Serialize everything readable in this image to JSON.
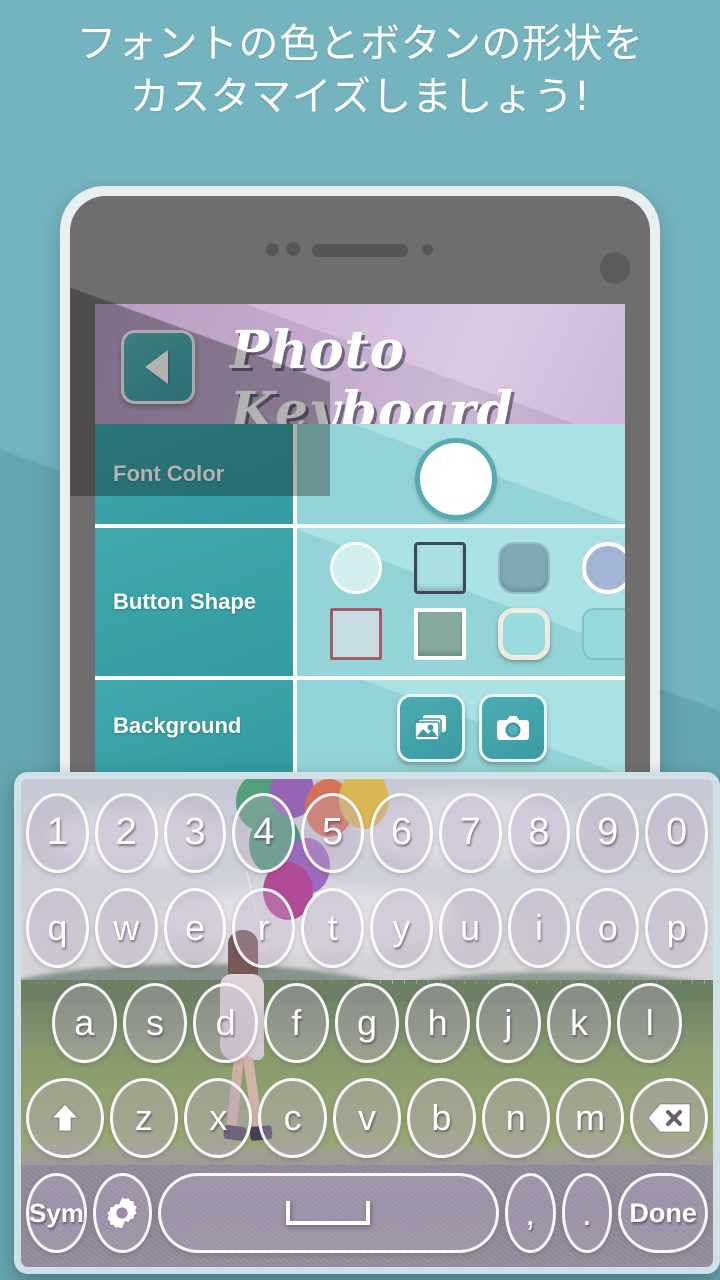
{
  "promo": {
    "line1": "フォントの色とボタンの形状を",
    "line2": "カスタマイズしましょう!",
    "text_color": "#ffffff",
    "background_color": "#6cafba"
  },
  "app": {
    "header": {
      "title": "Photo Keyboard",
      "back_icon": "back-triangle-icon",
      "background_color": "#cdb4d8",
      "back_button_color": "#47a6ac"
    },
    "settings_rows": [
      {
        "label": "Font Color",
        "type": "color",
        "swatches": [
          {
            "name": "white",
            "color": "#ffffff",
            "shape": "circle",
            "selected": true
          }
        ]
      },
      {
        "label": "Button Shape",
        "type": "shape",
        "swatches": [
          {
            "name": "circle-light",
            "shape": "circle",
            "color": "#d2eef0",
            "border": "#ffffff"
          },
          {
            "name": "square-dark-outline",
            "shape": "square",
            "color": "#a9dfe1",
            "border": "#3a4a4f"
          },
          {
            "name": "rounded-slate",
            "shape": "rounded",
            "color": "#7fa9b2",
            "border": "#93bcc4"
          },
          {
            "name": "circle-periwinkle",
            "shape": "circle",
            "color": "#a4b4d4",
            "border": "#ffffff"
          },
          {
            "name": "square-mauve-outline",
            "shape": "square",
            "color": "#c8dde2",
            "border": "#9d5c6a"
          },
          {
            "name": "square-sage",
            "shape": "square",
            "color": "#86a99e",
            "border": "#ffffff"
          },
          {
            "name": "rounded-cream-glow",
            "shape": "rounded",
            "color": "#9adcde",
            "border": "#eeeae2"
          },
          {
            "name": "rounded-teal-flat",
            "shape": "rounded",
            "color": "#95d9da",
            "border": "#7cc2c6"
          }
        ]
      },
      {
        "label": "Background",
        "type": "source",
        "buttons": [
          {
            "name": "gallery-icon",
            "label": "Gallery"
          },
          {
            "name": "camera-icon",
            "label": "Camera"
          }
        ]
      }
    ],
    "label_bg_color": "#3fa8ad",
    "body_bg_color": "#9adcde"
  },
  "keyboard": {
    "rows": [
      {
        "name": "number-row",
        "keys": [
          {
            "label": "1"
          },
          {
            "label": "2"
          },
          {
            "label": "3"
          },
          {
            "label": "4"
          },
          {
            "label": "5"
          },
          {
            "label": "6"
          },
          {
            "label": "7"
          },
          {
            "label": "8"
          },
          {
            "label": "9"
          },
          {
            "label": "0"
          }
        ]
      },
      {
        "name": "qwerty-row",
        "keys": [
          {
            "label": "q"
          },
          {
            "label": "w"
          },
          {
            "label": "e"
          },
          {
            "label": "r"
          },
          {
            "label": "t"
          },
          {
            "label": "y"
          },
          {
            "label": "u"
          },
          {
            "label": "i"
          },
          {
            "label": "o"
          },
          {
            "label": "p"
          }
        ]
      },
      {
        "name": "asdf-row",
        "keys": [
          {
            "label": "a"
          },
          {
            "label": "s"
          },
          {
            "label": "d"
          },
          {
            "label": "f"
          },
          {
            "label": "g"
          },
          {
            "label": "h"
          },
          {
            "label": "j"
          },
          {
            "label": "k"
          },
          {
            "label": "l"
          }
        ]
      },
      {
        "name": "zxcv-row",
        "keys": [
          {
            "label": "",
            "icon": "shift-arrow-icon"
          },
          {
            "label": "z"
          },
          {
            "label": "x"
          },
          {
            "label": "c"
          },
          {
            "label": "v"
          },
          {
            "label": "b"
          },
          {
            "label": "n"
          },
          {
            "label": "m"
          },
          {
            "label": "",
            "icon": "backspace-icon"
          }
        ]
      },
      {
        "name": "bottom-row",
        "keys": [
          {
            "label": "Sym"
          },
          {
            "label": "",
            "icon": "gear-icon"
          },
          {
            "label": "",
            "icon": "spacebar-icon"
          },
          {
            "label": ","
          },
          {
            "label": "."
          },
          {
            "label": "Done"
          }
        ]
      }
    ],
    "key_text_color": "#ffffff",
    "key_fill_color": "rgba(190,170,200,0.34)",
    "frame_color": "#cfe1e7"
  }
}
